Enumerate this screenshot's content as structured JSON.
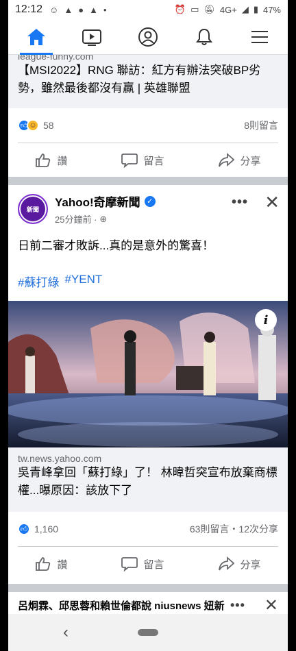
{
  "status_bar": {
    "time": "12:12",
    "network": "4G+",
    "battery": "47%"
  },
  "nav": {
    "items": [
      {
        "name": "home-icon",
        "active": true
      },
      {
        "name": "watch-icon"
      },
      {
        "name": "profile-icon"
      },
      {
        "name": "notifications-icon"
      },
      {
        "name": "menu-icon"
      }
    ]
  },
  "post1": {
    "link_domain": "league-funny.com",
    "link_title": "【MSI2022】RNG 聯訪：紅方有辦法突破BP劣勢，雖然最後都沒有贏 | 英雄聯盟",
    "reaction_count": "58",
    "comments": "8則留言",
    "actions": {
      "like": "讚",
      "comment": "留言",
      "share": "分享"
    }
  },
  "post2": {
    "page_name": "Yahoo!奇摩新聞",
    "avatar_text": "新聞",
    "time": "25分鐘前 ·",
    "text": "日前二審才敗訴...真的是意外的驚喜！",
    "hashtags": [
      "#蘇打綠",
      "#YENT"
    ],
    "link_domain": "tw.news.yahoo.com",
    "link_title": "吳青峰拿回「蘇打綠」了！ 林暐哲突宣布放棄商標權...曝原因：該放下了",
    "reaction_count": "1,160",
    "comments_shares": "63則留言・12次分享",
    "actions": {
      "like": "讚",
      "comment": "留言",
      "share": "分享"
    }
  },
  "post3": {
    "title": "呂炯霖、邱思蓉和賴世倫都說 niusnews 妞新"
  },
  "colors": {
    "brand": "#1877f2",
    "link": "#216fdb"
  }
}
